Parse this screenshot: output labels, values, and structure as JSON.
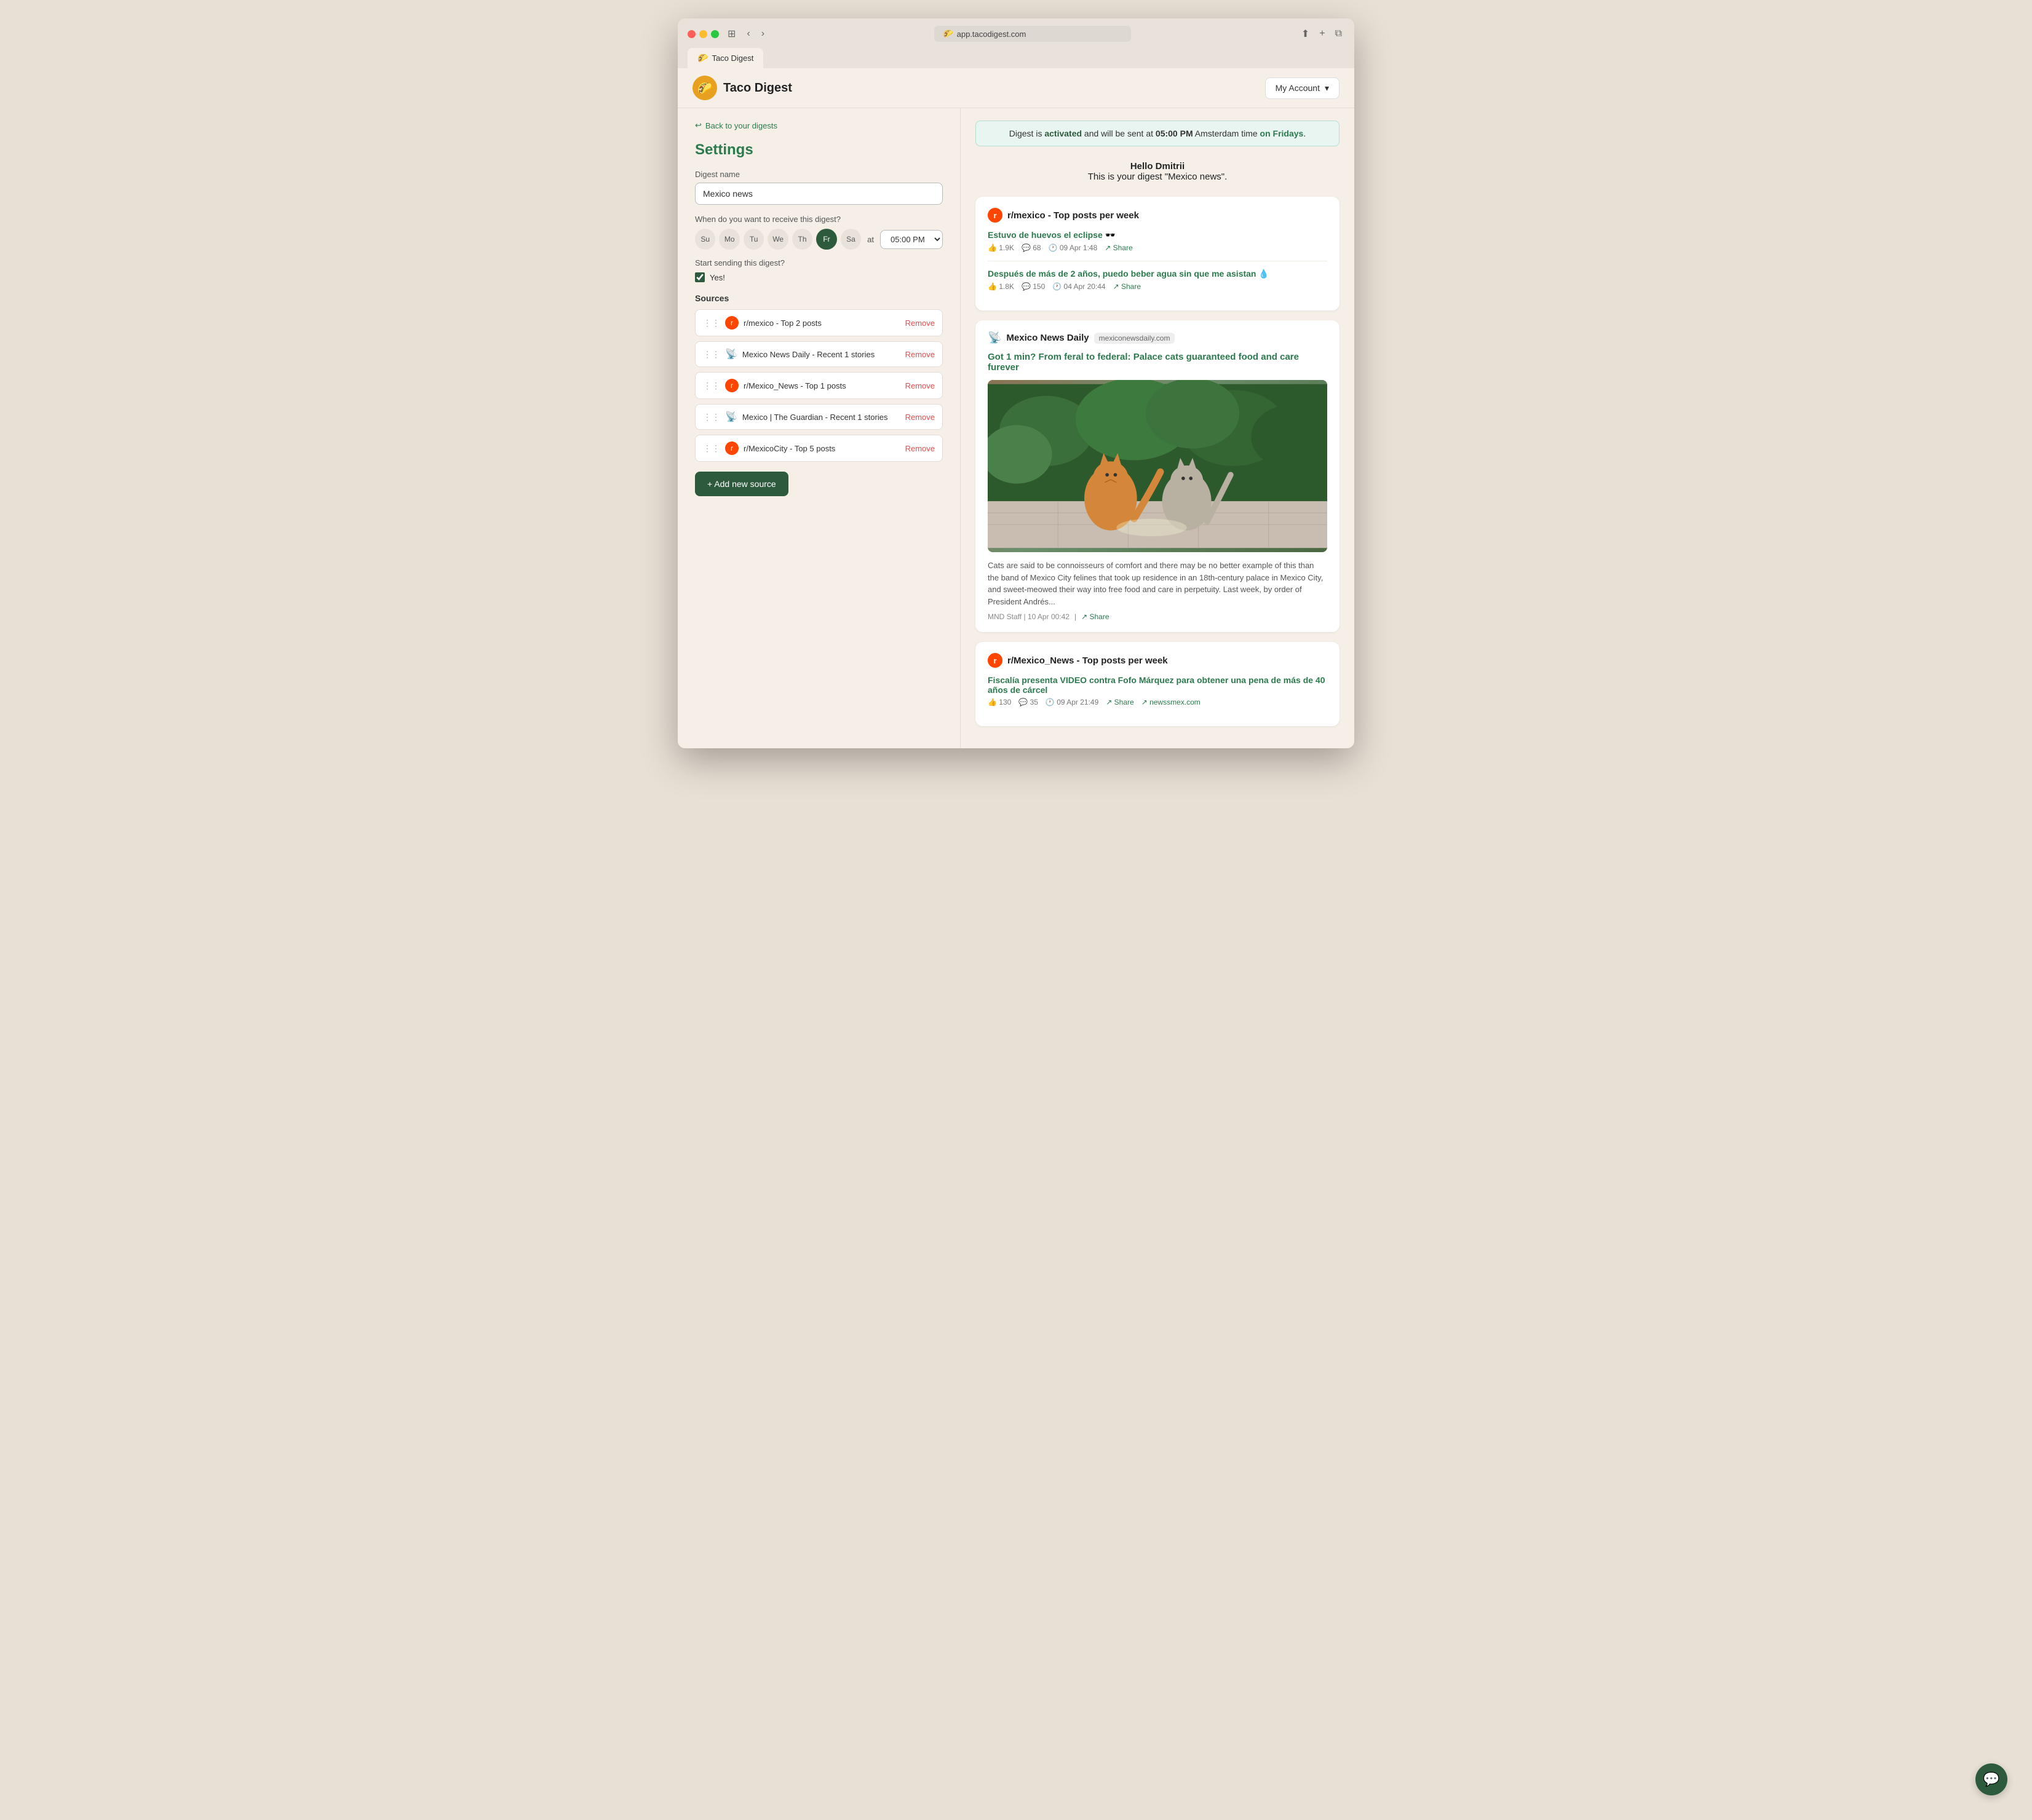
{
  "browser": {
    "url": "app.tacodigest.com",
    "tab_title": "Taco Digest",
    "tab_favicon": "🌮"
  },
  "header": {
    "app_name": "Taco Digest",
    "logo_emoji": "🌮",
    "my_account_label": "My Account"
  },
  "back_link": {
    "label": "Back to your digests"
  },
  "settings": {
    "title": "Settings",
    "digest_name_label": "Digest name",
    "digest_name_value": "Mexico news",
    "when_label": "When do you want to receive this digest?",
    "days": [
      {
        "label": "Su",
        "active": false
      },
      {
        "label": "Mo",
        "active": false
      },
      {
        "label": "Tu",
        "active": false
      },
      {
        "label": "We",
        "active": false
      },
      {
        "label": "Th",
        "active": false
      },
      {
        "label": "Fr",
        "active": true
      },
      {
        "label": "Sa",
        "active": false
      }
    ],
    "at_label": "at",
    "time_value": "05:00 PM",
    "start_sending_label": "Start sending this digest?",
    "yes_label": "Yes!",
    "sources_label": "Sources",
    "sources": [
      {
        "icon": "reddit",
        "name": "r/mexico - Top 2 posts"
      },
      {
        "icon": "rss",
        "name": "Mexico News Daily - Recent 1 stories"
      },
      {
        "icon": "reddit",
        "name": "r/Mexico_News - Top 1 posts"
      },
      {
        "icon": "rss",
        "name": "Mexico | The Guardian - Recent 1 stories"
      },
      {
        "icon": "reddit",
        "name": "r/MexicoCity - Top 5 posts"
      }
    ],
    "add_source_label": "+ Add new source",
    "remove_label": "Remove"
  },
  "digest": {
    "banner": "Digest is activated and will be sent at 05:00 PM Amsterdam time on Fridays.",
    "banner_activated": "activated",
    "banner_time": "05:00 PM",
    "banner_day": "on Fridays",
    "greeting_line1": "Hello Dmitrii",
    "greeting_line2": "This is your digest \"Mexico news\".",
    "cards": [
      {
        "type": "reddit",
        "source_title": "r/mexico - Top posts per week",
        "posts": [
          {
            "title": "Estuvo de huevos el eclipse 🕶️",
            "likes": "1.9K",
            "comments": "68",
            "time": "09 Apr 1:48",
            "share": "Share"
          },
          {
            "title": "Después de más de 2 años, puedo beber agua sin que me asistan 💧",
            "likes": "1.8K",
            "comments": "150",
            "time": "04 Apr 20:44",
            "share": "Share"
          }
        ]
      },
      {
        "type": "rss",
        "source_title": "Mexico News Daily",
        "domain": "mexiconewsdaily.com",
        "article_title": "Got 1 min? From feral to federal: Palace cats guaranteed food and care furever",
        "description": "Cats are said to be connoisseurs of comfort and there may be no better example of this than the band of Mexico City felines that took up residence in an 18th-century palace in Mexico City, and sweet-meowed their way into free food and care in perpetuity. Last week, by order of President Andrés...",
        "meta": "MND Staff | 10 Apr 00:42",
        "share": "Share"
      },
      {
        "type": "reddit",
        "source_title": "r/Mexico_News - Top posts per week",
        "posts": [
          {
            "title": "Fiscalía presenta VIDEO contra Fofo Márquez para obtener una pena de más de 40 años de cárcel",
            "likes": "130",
            "comments": "35",
            "time": "09 Apr 21:49",
            "share": "Share",
            "extra_link": "newssmex.com"
          }
        ]
      }
    ]
  }
}
